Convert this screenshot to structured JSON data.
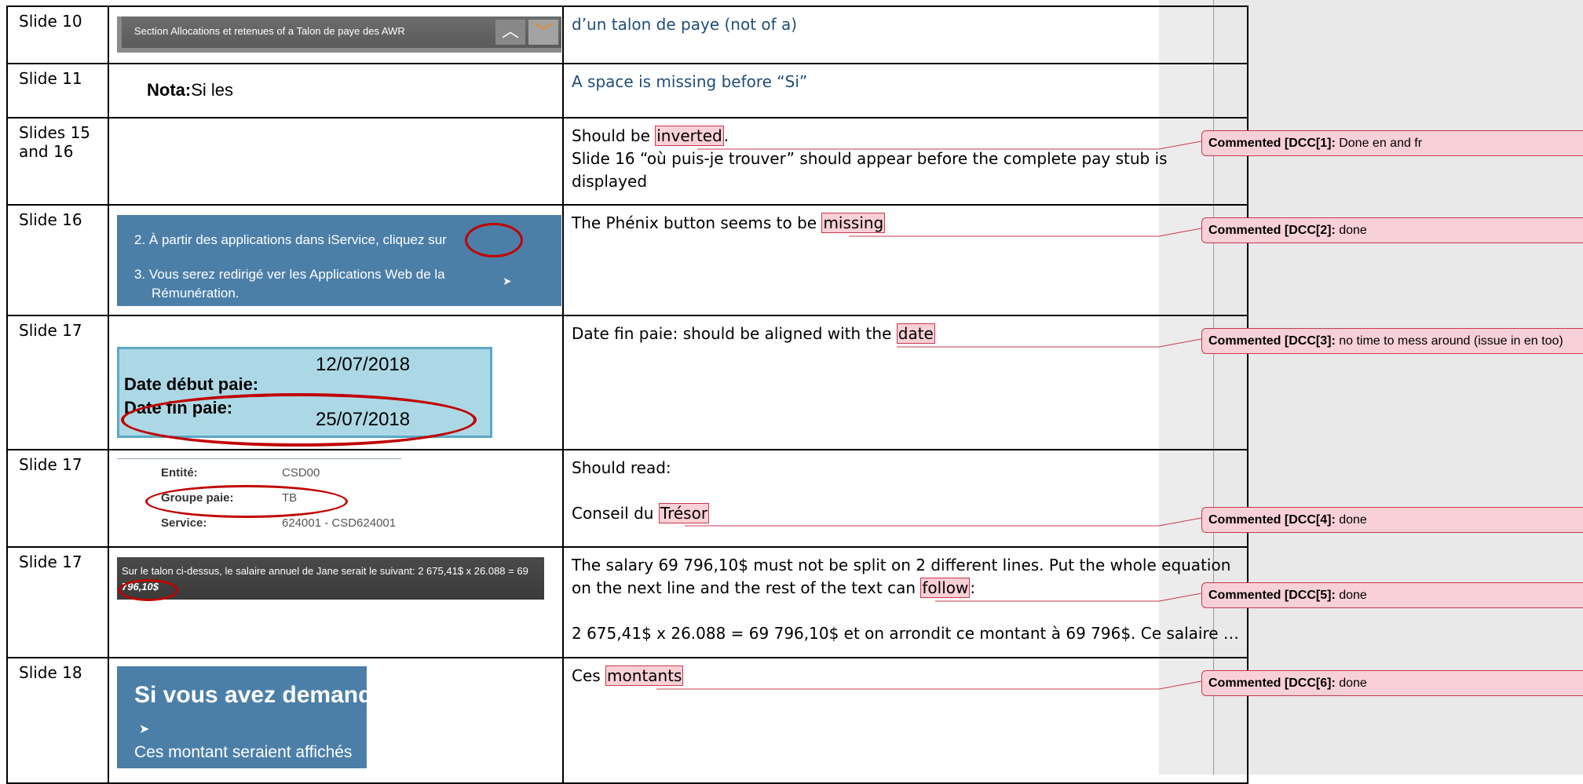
{
  "rows": [
    {
      "slide": "Slide 10",
      "thumb": {
        "text": "Section Allocations et retenues of a Talon de paye des AWR"
      },
      "comment_parts": [
        "d’un talon de paye (not of a)"
      ]
    },
    {
      "slide": "Slide 11",
      "thumb": {
        "bold": "Nota:",
        "text": "Si les"
      },
      "comment_parts": [
        "A space is missing before “Si”"
      ]
    },
    {
      "slide": "Slides 15 and 16",
      "line1_before": "Should be ",
      "line1_hl": "inverted",
      "line1_after": ".",
      "line2": "Slide 16 “où puis-je trouver” should appear before the complete pay stub is displayed"
    },
    {
      "slide": "Slide 16",
      "thumb": {
        "item2": "2. À partir des applications dans iService, cliquez sur",
        "item3a": "3. Vous serez redirigé ver les Applications Web de la",
        "item3b": "Rémunération."
      },
      "before": "The Phénix button seems to be ",
      "hl": "missing"
    },
    {
      "slide": "Slide 17",
      "thumb": {
        "date1": "12/07/2018",
        "label1": "Date début paie:",
        "label2": "Date fin paie:",
        "date2": "25/07/2018"
      },
      "before": "Date fin paie: should be aligned with the ",
      "hl": "date"
    },
    {
      "slide": "Slide 17",
      "thumb": {
        "r1l": "Entité:",
        "r1v": "CSD00",
        "r2l": "Groupe paie:",
        "r2v": "TB",
        "r3l": "Service:",
        "r3v": "624001 - CSD624001"
      },
      "line1": "Should read:",
      "before": "Conseil du ",
      "hl": "Trésor"
    },
    {
      "slide": "Slide 17",
      "thumb": {
        "l1": "Sur le talon ci-dessus, le salaire annuel de Jane serait le suivant: 2 675,41$ x 26.088 = 69",
        "l2": "796,10$"
      },
      "line1": "The salary 69 796,10$ must not be split on 2 different lines.  Put the whole equation",
      "line2_before": "on the next line and the rest of the text can ",
      "line2_hl": "follow",
      "line2_after": ":",
      "line3": "2 675,41$ x 26.088 = 69 796,10$  et on arrondit ce montant à 69 796$. Ce salaire …"
    },
    {
      "slide": "Slide 18",
      "thumb": {
        "heading": "Si vous avez demande",
        "para": "Ces montant seraient affichés"
      },
      "before": "Ces ",
      "hl": "montants"
    }
  ],
  "comments": [
    {
      "label": "Commented [DCC[1]:",
      "text": " Done en and fr"
    },
    {
      "label": "Commented [DCC[2]:",
      "text": " done"
    },
    {
      "label": "Commented [DCC[3]:",
      "text": " no time to mess around (issue in en too)"
    },
    {
      "label": "Commented [DCC[4]:",
      "text": " done"
    },
    {
      "label": "Commented [DCC[5]:",
      "text": " done"
    },
    {
      "label": "Commented [DCC[6]:",
      "text": " done"
    }
  ],
  "colors": {
    "highlight": "#f9d0d6",
    "comment_border": "#c8384d",
    "link_blue": "#1f4e79",
    "oval_red": "#c00000"
  }
}
